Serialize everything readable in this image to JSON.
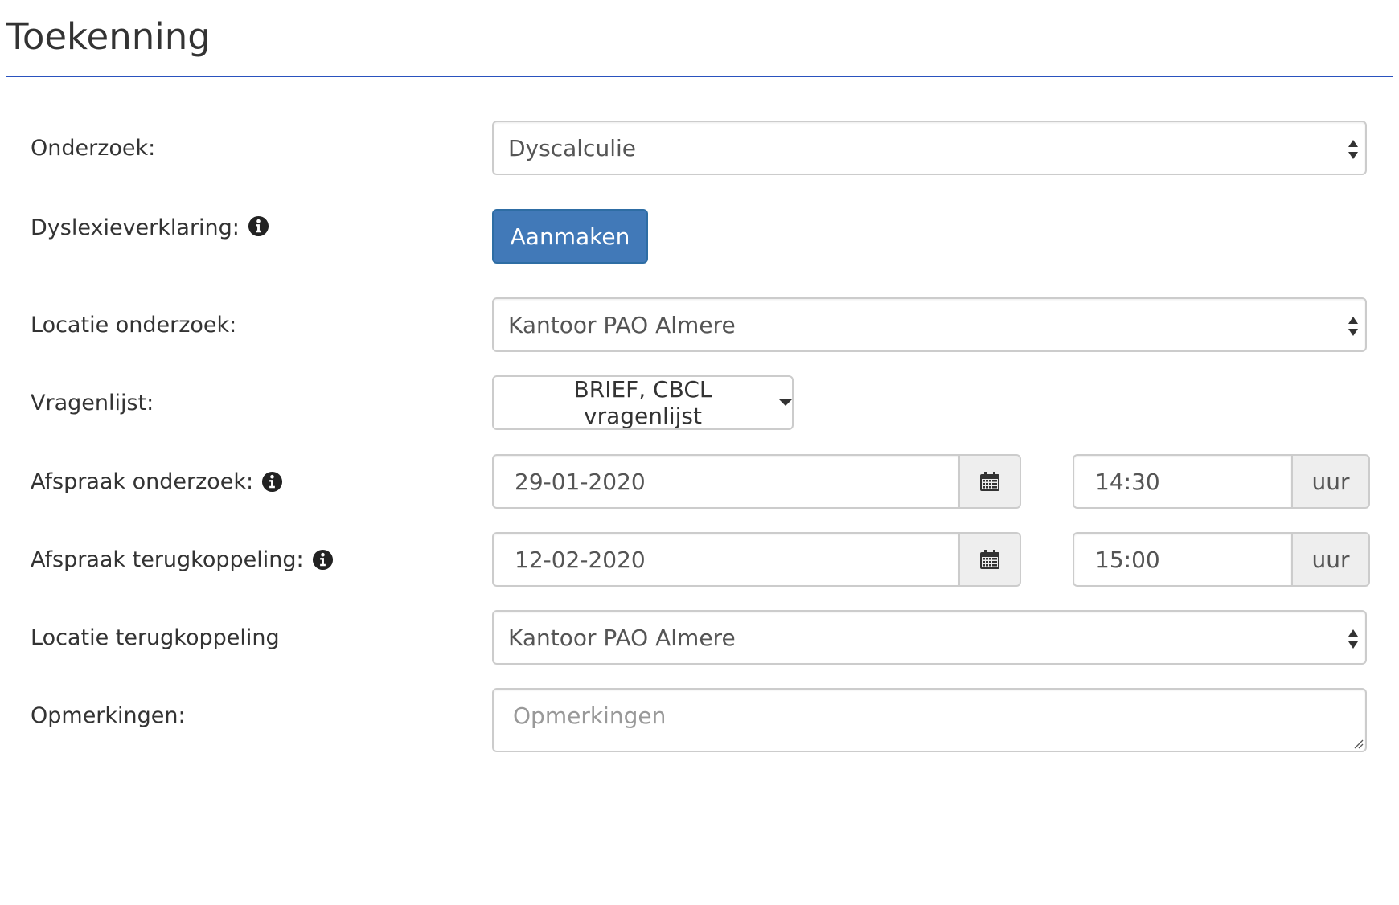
{
  "page": {
    "title": "Toekenning"
  },
  "form": {
    "onderzoek": {
      "label": "Onderzoek:",
      "value": "Dyscalculie"
    },
    "dyslexieverklaring": {
      "label": "Dyslexieverklaring:",
      "button_label": "Aanmaken"
    },
    "locatie_onderzoek": {
      "label": "Locatie onderzoek:",
      "value": "Kantoor PAO Almere"
    },
    "vragenlijst": {
      "label": "Vragenlijst:",
      "value": "BRIEF, CBCL vragenlijst"
    },
    "afspraak_onderzoek": {
      "label": "Afspraak onderzoek:",
      "date": "29-01-2020",
      "time": "14:30",
      "time_unit": "uur"
    },
    "afspraak_terugkoppeling": {
      "label": "Afspraak terugkoppeling:",
      "date": "12-02-2020",
      "time": "15:00",
      "time_unit": "uur"
    },
    "locatie_terugkoppeling": {
      "label": "Locatie terugkoppeling",
      "value": "Kantoor PAO Almere"
    },
    "opmerkingen": {
      "label": "Opmerkingen:",
      "placeholder": "Opmerkingen"
    }
  },
  "icons": {
    "info": "info-circle-icon",
    "calendar": "calendar-icon",
    "select_arrows": "select-arrows-icon",
    "caret": "caret-down-icon"
  },
  "colors": {
    "primary_button": "#4179b8",
    "title_rule": "#2a52be",
    "addon_background": "#eeeeee",
    "border": "#cccccc"
  }
}
